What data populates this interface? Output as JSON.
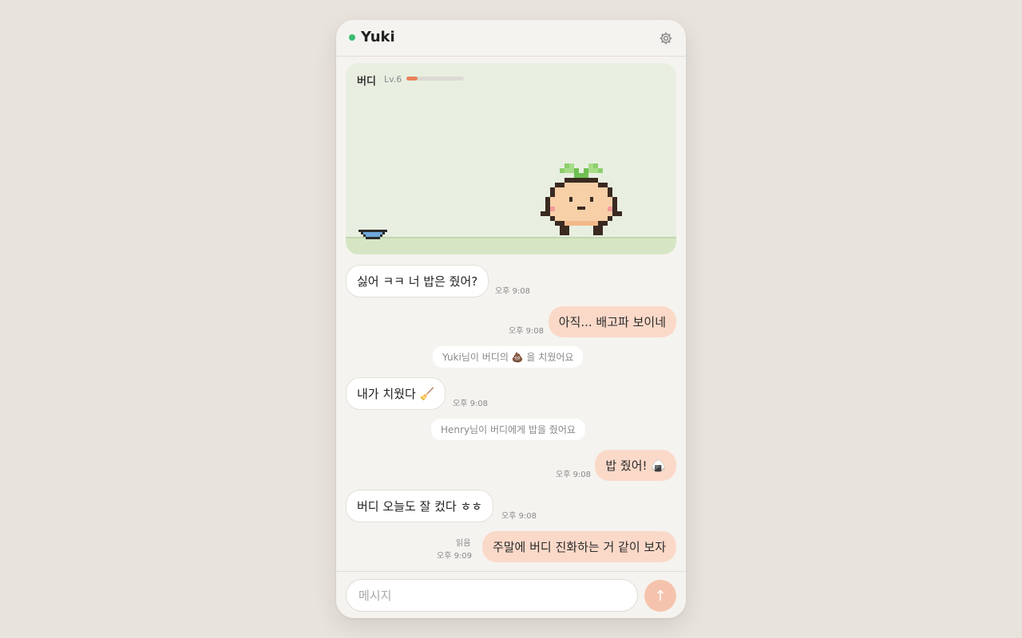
{
  "header": {
    "title": "Yuki",
    "status_color": "#3dbb72",
    "settings_icon": "gear-icon"
  },
  "pet": {
    "name": "버디",
    "level": "Lv.6",
    "xp_progress": 0.2,
    "character": "onion-sprout-buddy",
    "bowl": "food-bowl-icon"
  },
  "messages": [
    {
      "type": "in",
      "text": "싫어 ㅋㅋ 너 밥은 줬어?",
      "time": "오후 9:08"
    },
    {
      "type": "out",
      "text": "아직... 배고파 보이네",
      "time": "오후 9:08"
    },
    {
      "type": "system",
      "text": "Yuki님이 버디의 💩 을 치웠어요"
    },
    {
      "type": "in",
      "text": "내가 치웠다 🧹",
      "time": "오후 9:08"
    },
    {
      "type": "system",
      "text": "Henry님이 버디에게 밥을 줬어요"
    },
    {
      "type": "out",
      "text": "밥 줬어! 🍙",
      "time": "오후 9:08"
    },
    {
      "type": "in",
      "text": "버디 오늘도 잘 컸다 ㅎㅎ",
      "time": "오후 9:08"
    },
    {
      "type": "out",
      "text": "주말에 버디 진화하는 거 같이 보자",
      "time": "오후 9:09",
      "read": "읽음"
    }
  ],
  "composer": {
    "placeholder": "메시지",
    "send_icon": "arrow-up-icon",
    "value": ""
  }
}
